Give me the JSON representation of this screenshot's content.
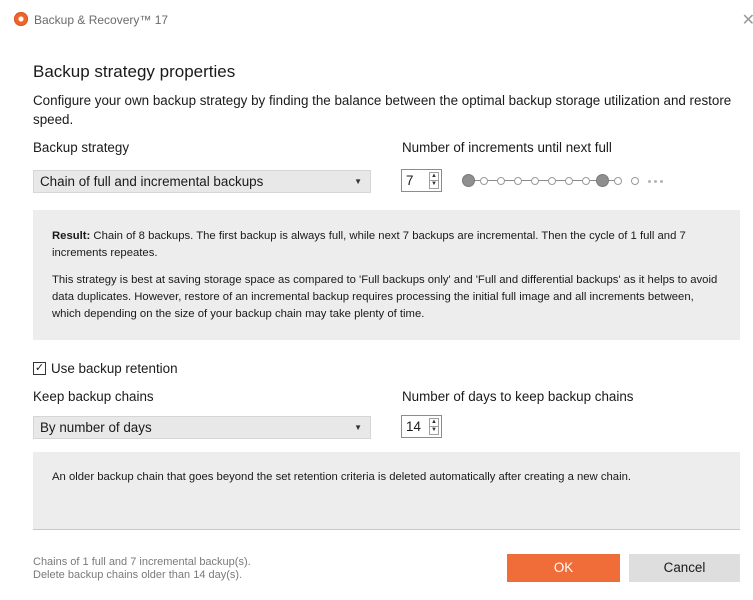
{
  "window": {
    "title": "Backup & Recovery™ 17",
    "close_symbol": "✕"
  },
  "heading": "Backup strategy properties",
  "description": "Configure your own backup strategy by finding the balance between the optimal backup storage utilization and restore speed.",
  "strategy": {
    "label": "Backup strategy",
    "selected": "Chain of full and incremental backups"
  },
  "increments": {
    "label": "Number of increments until next full",
    "value": "7",
    "chain_visual": {
      "total_backups": 8,
      "full_positions": [
        1,
        8
      ],
      "shown_dots": 11
    }
  },
  "result_panel": {
    "result_label": "Result:",
    "result_text": " Chain of 8 backups. The first backup is always full, while next 7 backups are incremental. Then the cycle of 1 full and 7 increments repeates.",
    "explanation": "This strategy is best at saving storage space as compared to 'Full backups only' and 'Full and differential backups' as it helps to avoid data duplicates. However, restore of an incremental backup requires processing the initial full image and all increments between, which depending on the size of your backup chain may take plenty of time."
  },
  "retention": {
    "checkbox_label": "Use backup retention",
    "checked": true,
    "check_symbol": "✓",
    "keep_label": "Keep backup chains",
    "keep_selected": "By number of days",
    "days_label": "Number of days to keep backup chains",
    "days_value": "14",
    "info": "An older backup chain that goes beyond the set retention criteria is deleted automatically after creating a new chain."
  },
  "footer": {
    "summary_line1": "Chains of 1 full and 7 incremental backup(s).",
    "summary_line2": "Delete backup chains older than 14 day(s).",
    "ok_label": "OK",
    "cancel_label": "Cancel"
  },
  "colors": {
    "accent": "#f06d3a",
    "panel": "#ededed",
    "select_bg": "#e8e8e8"
  }
}
